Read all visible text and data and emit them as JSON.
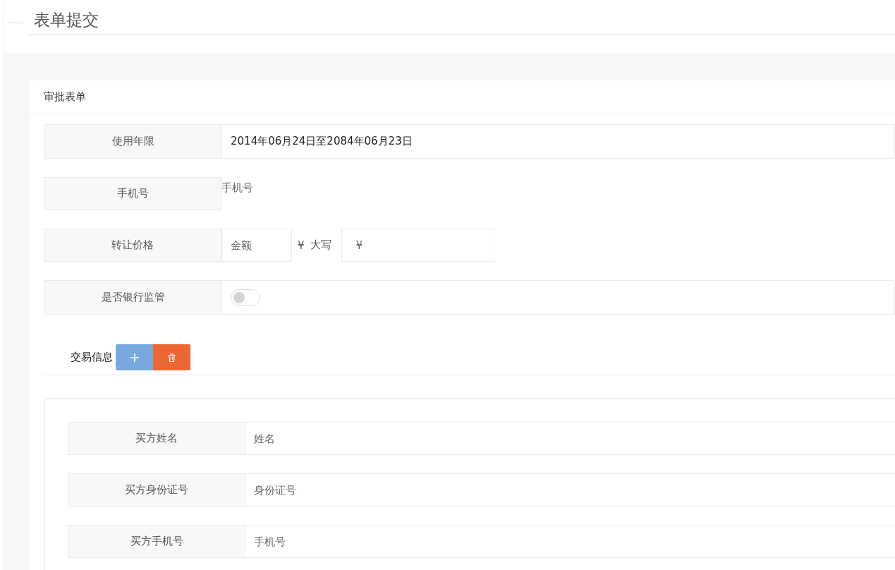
{
  "page_title": "表单提交",
  "card": {
    "title": "审批表单",
    "rows": [
      {
        "kind": "text",
        "label": "使用年限",
        "value": "2014年06月24日至2084年06月23日"
      },
      {
        "kind": "bare-input",
        "label": "手机号",
        "placeholder": "手机号"
      },
      {
        "kind": "price",
        "label": "转让价格",
        "amount_placeholder": "金额",
        "currency": "¥",
        "uppercase_label": "大写",
        "uppercase_placeholder": "¥"
      },
      {
        "kind": "switch",
        "label": "是否银行监管",
        "on": false
      }
    ]
  },
  "trade_section": {
    "title": "交易信息",
    "rows": [
      {
        "label": "买方姓名",
        "placeholder": "姓名"
      },
      {
        "label": "买方身份证号",
        "placeholder": "身份证号"
      },
      {
        "label": "买方手机号",
        "placeholder": "手机号"
      }
    ]
  }
}
